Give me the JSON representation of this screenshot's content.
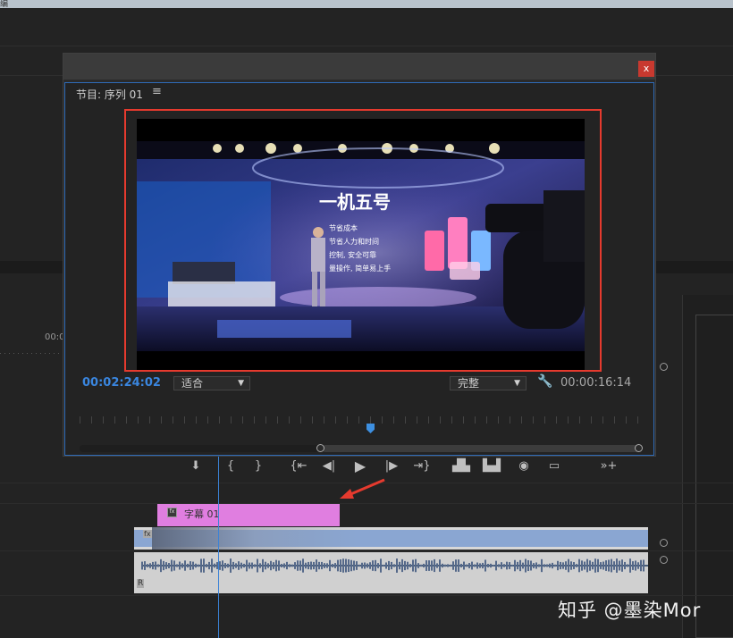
{
  "app": {
    "corner_label": "编"
  },
  "monitor": {
    "panel_title": "节目: 序列 01",
    "menu_icon": "≡",
    "close_label": "x",
    "current_time": "00:02:24:02",
    "fit_select": "适合",
    "quality_select": "完整",
    "duration": "00:00:16:14",
    "video": {
      "headline": "一机五号",
      "bullets": [
        "节省成本",
        "节省人力和时间",
        "控制, 安全可靠",
        "量操作, 简单易上手"
      ]
    }
  },
  "controls": [
    {
      "name": "add-marker-button",
      "glyph": "⬇"
    },
    {
      "name": "mark-in-button",
      "glyph": "{"
    },
    {
      "name": "mark-out-button",
      "glyph": "}"
    },
    {
      "name": "go-to-in-button",
      "glyph": "{⇤"
    },
    {
      "name": "step-back-button",
      "glyph": "◀|"
    },
    {
      "name": "play-button",
      "glyph": "▶"
    },
    {
      "name": "step-forward-button",
      "glyph": "|▶"
    },
    {
      "name": "go-to-out-button",
      "glyph": "⇥}"
    },
    {
      "name": "lift-button",
      "glyph": "▟▙"
    },
    {
      "name": "extract-button",
      "glyph": "▙▟"
    },
    {
      "name": "export-frame-button",
      "glyph": "◉"
    },
    {
      "name": "safe-margins-button",
      "glyph": "▭"
    },
    {
      "name": "button-editor-button",
      "glyph": "»+"
    }
  ],
  "timeline": {
    "ruler_time": "00:0",
    "adjustment_clip": "字幕 01",
    "fx_badge": "fx",
    "video_track_marker": "fx",
    "audio_track_marker": "R"
  },
  "watermark": "知乎 @墨染Mor",
  "colors": {
    "accent_blue": "#3b82d6",
    "highlight_red": "#e53a2e",
    "adjustment_pink": "#e07ee0"
  }
}
